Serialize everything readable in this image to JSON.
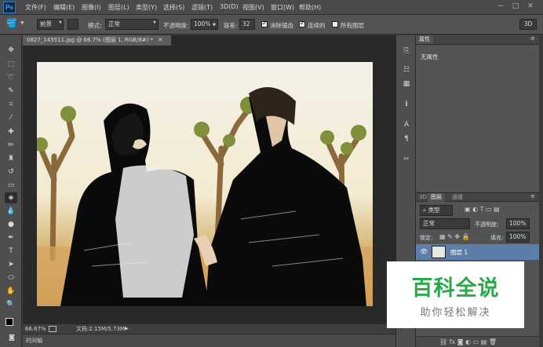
{
  "app": {
    "logo": "Ps"
  },
  "menu": [
    "文件(F)",
    "编辑(E)",
    "图像(I)",
    "图层(L)",
    "类型(Y)",
    "选择(S)",
    "滤镜(T)",
    "3D(D)",
    "视图(V)",
    "窗口(W)",
    "帮助(H)"
  ],
  "options": {
    "fill_source": "前景",
    "mode_label": "模式:",
    "mode_value": "正常",
    "opacity_label": "不透明度:",
    "opacity_value": "100%",
    "tolerance_label": "容差:",
    "tolerance_value": "32",
    "antialias_label": "消除锯齿",
    "contiguous_label": "连续的",
    "all_layers_label": "所有图层",
    "mode3d": "3D"
  },
  "document": {
    "tab_title": "0827_145511.jpg @ 66.7% (图层 1, RGB/8#) *",
    "zoom": "66.67%",
    "doc_size": "文档:2.15M/5.73M",
    "timeline_label": "时间轴"
  },
  "properties": {
    "tab": "属性",
    "content": "无属性"
  },
  "layers": {
    "tabs": [
      "3D",
      "图层",
      "通道"
    ],
    "filter_kind": "类型",
    "blend_mode": "正常",
    "opacity_label": "不透明度:",
    "opacity_value": "100%",
    "lock_label": "锁定:",
    "fill_label": "填充:",
    "fill_value": "100%",
    "layer_name": "图层 1"
  },
  "watermark": {
    "title": "百科全说",
    "subtitle": "助你轻松解决"
  },
  "colors": {
    "accent": "#2aa84a",
    "selected_layer": "#5d7ea8"
  }
}
